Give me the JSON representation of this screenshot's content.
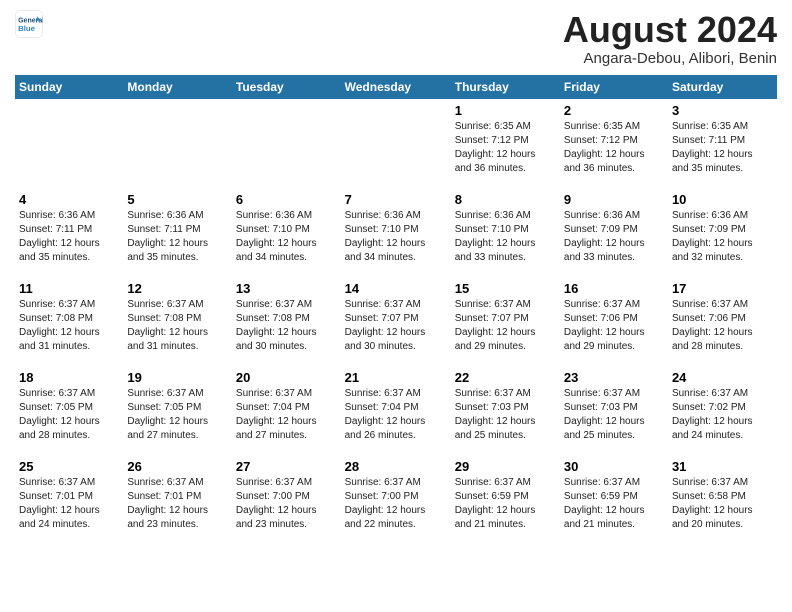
{
  "logo": {
    "line1": "General",
    "line2": "Blue"
  },
  "title": "August 2024",
  "subtitle": "Angara-Debou, Alibori, Benin",
  "days_of_week": [
    "Sunday",
    "Monday",
    "Tuesday",
    "Wednesday",
    "Thursday",
    "Friday",
    "Saturday"
  ],
  "weeks": [
    {
      "days": [
        {
          "num": "",
          "detail": ""
        },
        {
          "num": "",
          "detail": ""
        },
        {
          "num": "",
          "detail": ""
        },
        {
          "num": "",
          "detail": ""
        },
        {
          "num": "1",
          "detail": "Sunrise: 6:35 AM\nSunset: 7:12 PM\nDaylight: 12 hours\nand 36 minutes."
        },
        {
          "num": "2",
          "detail": "Sunrise: 6:35 AM\nSunset: 7:12 PM\nDaylight: 12 hours\nand 36 minutes."
        },
        {
          "num": "3",
          "detail": "Sunrise: 6:35 AM\nSunset: 7:11 PM\nDaylight: 12 hours\nand 35 minutes."
        }
      ]
    },
    {
      "days": [
        {
          "num": "4",
          "detail": "Sunrise: 6:36 AM\nSunset: 7:11 PM\nDaylight: 12 hours\nand 35 minutes."
        },
        {
          "num": "5",
          "detail": "Sunrise: 6:36 AM\nSunset: 7:11 PM\nDaylight: 12 hours\nand 35 minutes."
        },
        {
          "num": "6",
          "detail": "Sunrise: 6:36 AM\nSunset: 7:10 PM\nDaylight: 12 hours\nand 34 minutes."
        },
        {
          "num": "7",
          "detail": "Sunrise: 6:36 AM\nSunset: 7:10 PM\nDaylight: 12 hours\nand 34 minutes."
        },
        {
          "num": "8",
          "detail": "Sunrise: 6:36 AM\nSunset: 7:10 PM\nDaylight: 12 hours\nand 33 minutes."
        },
        {
          "num": "9",
          "detail": "Sunrise: 6:36 AM\nSunset: 7:09 PM\nDaylight: 12 hours\nand 33 minutes."
        },
        {
          "num": "10",
          "detail": "Sunrise: 6:36 AM\nSunset: 7:09 PM\nDaylight: 12 hours\nand 32 minutes."
        }
      ]
    },
    {
      "days": [
        {
          "num": "11",
          "detail": "Sunrise: 6:37 AM\nSunset: 7:08 PM\nDaylight: 12 hours\nand 31 minutes."
        },
        {
          "num": "12",
          "detail": "Sunrise: 6:37 AM\nSunset: 7:08 PM\nDaylight: 12 hours\nand 31 minutes."
        },
        {
          "num": "13",
          "detail": "Sunrise: 6:37 AM\nSunset: 7:08 PM\nDaylight: 12 hours\nand 30 minutes."
        },
        {
          "num": "14",
          "detail": "Sunrise: 6:37 AM\nSunset: 7:07 PM\nDaylight: 12 hours\nand 30 minutes."
        },
        {
          "num": "15",
          "detail": "Sunrise: 6:37 AM\nSunset: 7:07 PM\nDaylight: 12 hours\nand 29 minutes."
        },
        {
          "num": "16",
          "detail": "Sunrise: 6:37 AM\nSunset: 7:06 PM\nDaylight: 12 hours\nand 29 minutes."
        },
        {
          "num": "17",
          "detail": "Sunrise: 6:37 AM\nSunset: 7:06 PM\nDaylight: 12 hours\nand 28 minutes."
        }
      ]
    },
    {
      "days": [
        {
          "num": "18",
          "detail": "Sunrise: 6:37 AM\nSunset: 7:05 PM\nDaylight: 12 hours\nand 28 minutes."
        },
        {
          "num": "19",
          "detail": "Sunrise: 6:37 AM\nSunset: 7:05 PM\nDaylight: 12 hours\nand 27 minutes."
        },
        {
          "num": "20",
          "detail": "Sunrise: 6:37 AM\nSunset: 7:04 PM\nDaylight: 12 hours\nand 27 minutes."
        },
        {
          "num": "21",
          "detail": "Sunrise: 6:37 AM\nSunset: 7:04 PM\nDaylight: 12 hours\nand 26 minutes."
        },
        {
          "num": "22",
          "detail": "Sunrise: 6:37 AM\nSunset: 7:03 PM\nDaylight: 12 hours\nand 25 minutes."
        },
        {
          "num": "23",
          "detail": "Sunrise: 6:37 AM\nSunset: 7:03 PM\nDaylight: 12 hours\nand 25 minutes."
        },
        {
          "num": "24",
          "detail": "Sunrise: 6:37 AM\nSunset: 7:02 PM\nDaylight: 12 hours\nand 24 minutes."
        }
      ]
    },
    {
      "days": [
        {
          "num": "25",
          "detail": "Sunrise: 6:37 AM\nSunset: 7:01 PM\nDaylight: 12 hours\nand 24 minutes."
        },
        {
          "num": "26",
          "detail": "Sunrise: 6:37 AM\nSunset: 7:01 PM\nDaylight: 12 hours\nand 23 minutes."
        },
        {
          "num": "27",
          "detail": "Sunrise: 6:37 AM\nSunset: 7:00 PM\nDaylight: 12 hours\nand 23 minutes."
        },
        {
          "num": "28",
          "detail": "Sunrise: 6:37 AM\nSunset: 7:00 PM\nDaylight: 12 hours\nand 22 minutes."
        },
        {
          "num": "29",
          "detail": "Sunrise: 6:37 AM\nSunset: 6:59 PM\nDaylight: 12 hours\nand 21 minutes."
        },
        {
          "num": "30",
          "detail": "Sunrise: 6:37 AM\nSunset: 6:59 PM\nDaylight: 12 hours\nand 21 minutes."
        },
        {
          "num": "31",
          "detail": "Sunrise: 6:37 AM\nSunset: 6:58 PM\nDaylight: 12 hours\nand 20 minutes."
        }
      ]
    }
  ]
}
